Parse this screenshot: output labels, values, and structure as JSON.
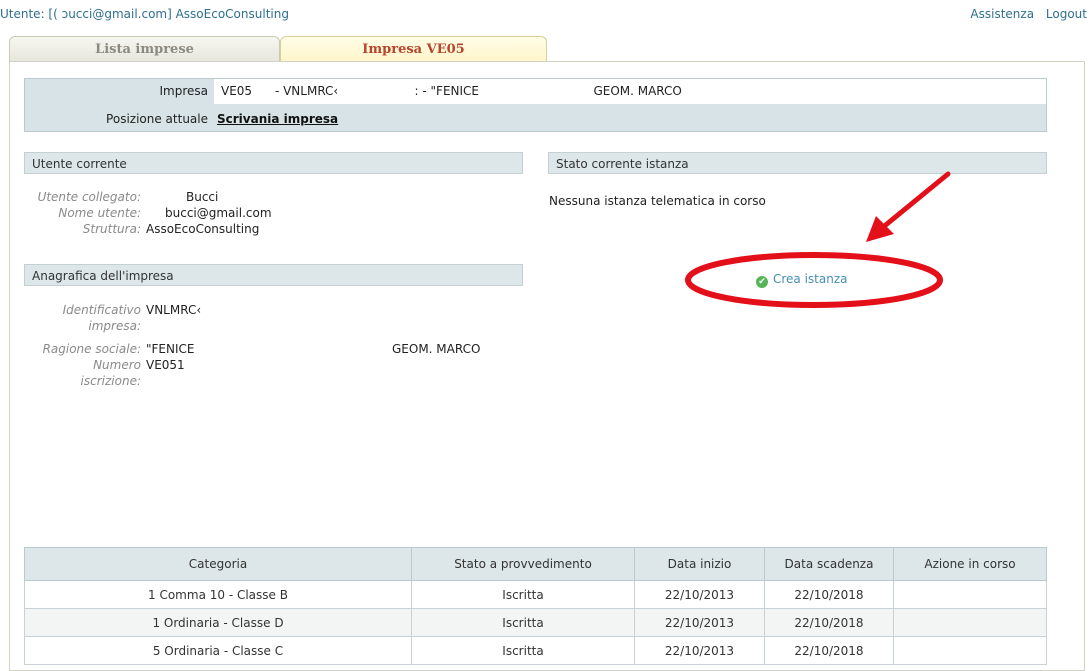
{
  "topbar": {
    "user": "Utente: [( ɔucci@gmail.com] AssoEcoConsulting",
    "assistenza": "Assistenza",
    "logout": "Logout"
  },
  "tabs": [
    {
      "label": "Lista imprese"
    },
    {
      "label": "Impresa VE05"
    }
  ],
  "impresa_box": {
    "impresa_label": "Impresa",
    "impresa_value": "VE05      - VNLMRC‹                    : - \"FENICE                              GEOM. MARCO",
    "posizione_label": "Posizione attuale",
    "posizione_value": "Scrivania impresa"
  },
  "utente_corrente": {
    "title": "Utente corrente",
    "collegato_label": "Utente collegato:",
    "collegato_value": "Bucci",
    "nome_label": "Nome utente:",
    "nome_value": "bucci@gmail.com",
    "struttura_label": "Struttura:",
    "struttura_value": "AssoEcoConsulting"
  },
  "stato": {
    "title": "Stato corrente istanza",
    "message": "Nessuna istanza telematica in corso",
    "crea_label": "Crea istanza"
  },
  "anagrafica": {
    "title": "Anagrafica dell'impresa",
    "id_label_1": "Identificativo",
    "id_label_2": "impresa:",
    "id_value": "VNLMRC‹",
    "ragione_label": "Ragione sociale:",
    "ragione_value": "\"FENICE",
    "ragione_value_2": "GEOM. MARCO",
    "numero_label_1": "Numero",
    "numero_label_2": "iscrizione:",
    "numero_value": "VE051"
  },
  "table": {
    "headers": [
      "Categoria",
      "Stato a provvedimento",
      "Data inizio",
      "Data scadenza",
      "Azione in corso"
    ],
    "rows": [
      [
        "1 Comma 10 - Classe B",
        "Iscritta",
        "22/10/2013",
        "22/10/2018",
        ""
      ],
      [
        "1 Ordinaria - Classe D",
        "Iscritta",
        "22/10/2013",
        "22/10/2018",
        ""
      ],
      [
        "5 Ordinaria - Classe C",
        "Iscritta",
        "22/10/2013",
        "22/10/2018",
        ""
      ]
    ]
  },
  "colors": {
    "accent_red": "#e3101a",
    "link_blue": "#2f6f8f",
    "header_bg": "#dde7ea"
  }
}
